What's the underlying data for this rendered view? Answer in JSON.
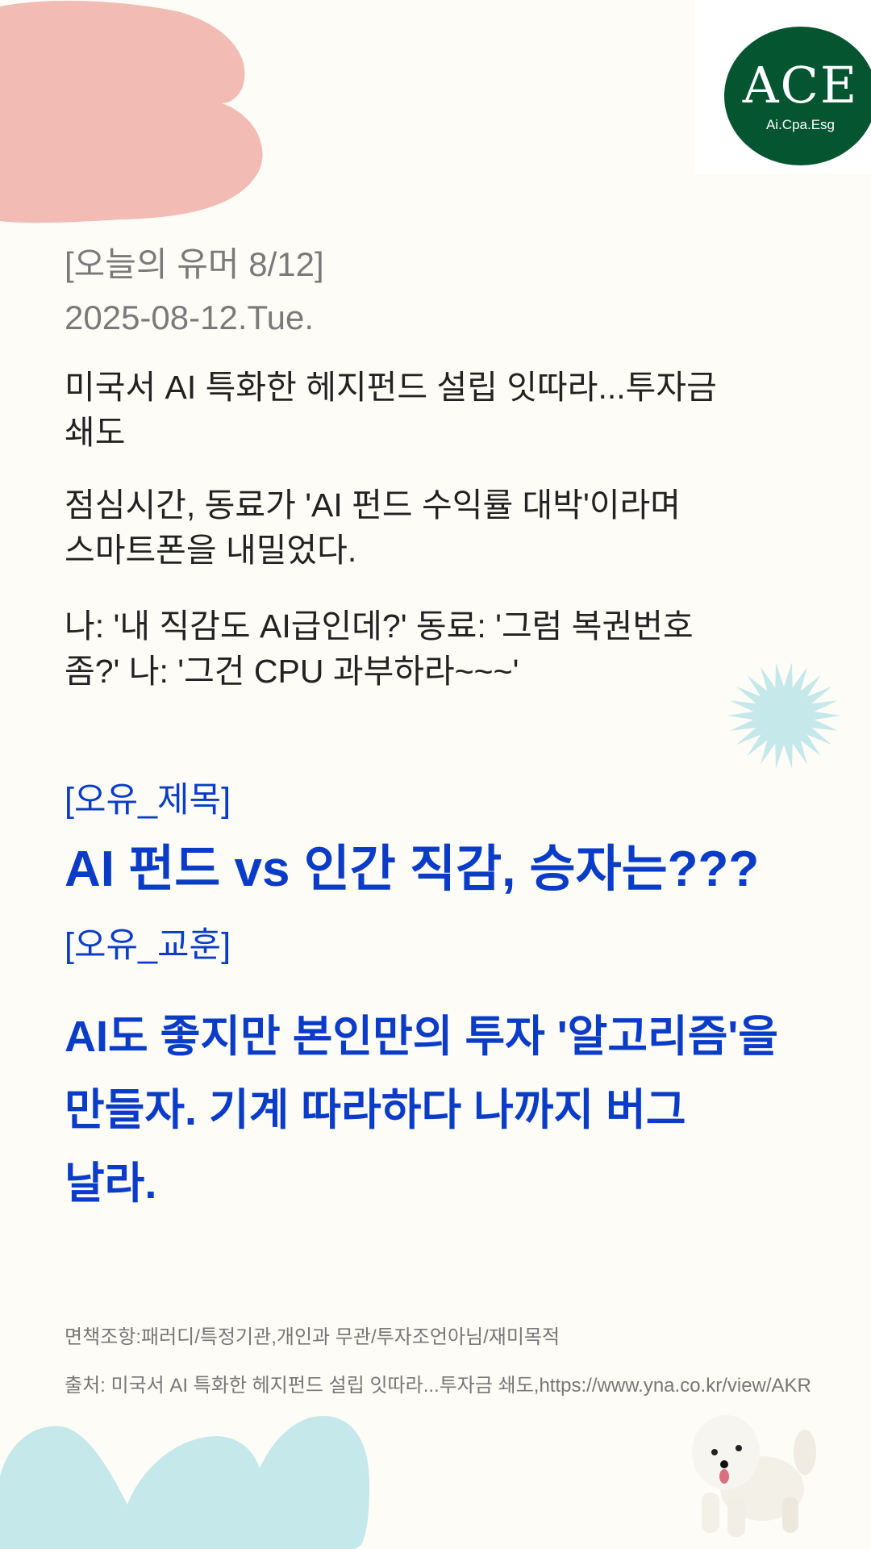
{
  "header": {
    "kicker": "[오늘의 유머 8/12]",
    "date": "2025-08-12.Tue."
  },
  "logo": {
    "text": "ACE",
    "subtitle": "Ai.Cpa.Esg"
  },
  "news": {
    "headline_lines": [
      "미국서 AI 특화한 헤지펀드 설립 잇따라...투자금",
      "쇄도"
    ],
    "story_lines": [
      "점심시간, 동료가 'AI 펀드 수익률 대박'이라며",
      "스마트폰을 내밀었다."
    ],
    "dialogue_lines": [
      "나: '내 직감도 AI급인데?' 동료: '그럼 복권번호",
      "좀?' 나: '그건 CPU 과부하라~~~'"
    ]
  },
  "humor": {
    "title_tag": "[오유_제목]",
    "title": "AI 펀드 vs 인간 직감, 승자는???",
    "lesson_tag": "[오유_교훈]",
    "lesson_lines": [
      "AI도 좋지만 본인만의 투자 '알고리즘'을",
      "만들자. 기계 따라하다 나까지 버그",
      "날라."
    ]
  },
  "footer": {
    "disclaimer": "면책조항:패러디/특정기관,개인과 무관/투자조언아님/재미목적",
    "source": "출처: 미국서 AI 특화한 헤지펀드 설립 잇따라...투자금 쇄도,https://www.yna.co.kr/view/AKR"
  },
  "colors": {
    "accent": "#0a3cc8",
    "logo_green": "#045530",
    "pink_blob": "#f2bcb4",
    "blue_blob": "#c5e8eb",
    "background": "#fdfcf7"
  }
}
